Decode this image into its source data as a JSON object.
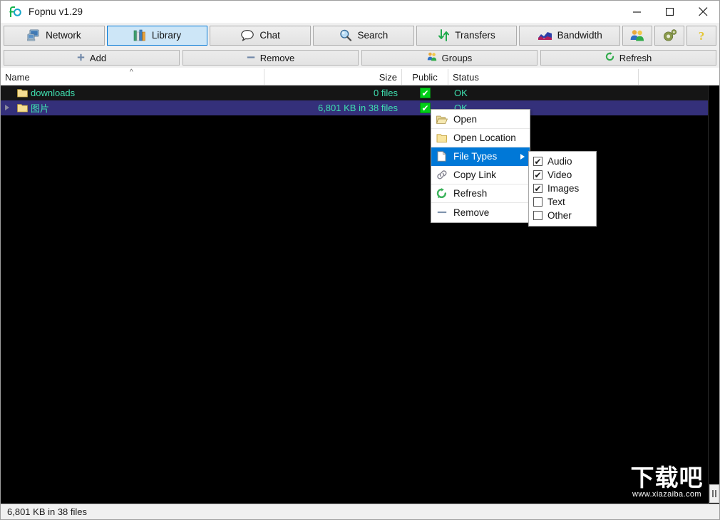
{
  "window": {
    "title": "Fopnu v1.29",
    "logo_icon": "fopnu-logo-icon",
    "minimize_label": "—",
    "maximize_label": "□",
    "close_label": "✕"
  },
  "tabs": [
    {
      "label": "Network",
      "icon": "computer-network-icon",
      "active": false
    },
    {
      "label": "Library",
      "icon": "books-library-icon",
      "active": true
    },
    {
      "label": "Chat",
      "icon": "speech-bubble-icon",
      "active": false
    },
    {
      "label": "Search",
      "icon": "magnifier-icon",
      "active": false
    },
    {
      "label": "Transfers",
      "icon": "up-down-arrows-icon",
      "active": false
    },
    {
      "label": "Bandwidth",
      "icon": "area-chart-icon",
      "active": false
    },
    {
      "label": "",
      "icon": "users-group-icon",
      "active": false
    },
    {
      "label": "",
      "icon": "gear-settings-icon",
      "active": false
    },
    {
      "label": "",
      "icon": "question-help-icon",
      "active": false
    }
  ],
  "actions": [
    {
      "label": "Add",
      "icon": "plus-icon"
    },
    {
      "label": "Remove",
      "icon": "minus-icon"
    },
    {
      "label": "Groups",
      "icon": "groups-icon"
    },
    {
      "label": "Refresh",
      "icon": "refresh-icon"
    }
  ],
  "table": {
    "columns": [
      {
        "label": "Name",
        "sort": "ascending"
      },
      {
        "label": "Size",
        "sort": ""
      },
      {
        "label": "Public",
        "sort": ""
      },
      {
        "label": "Status",
        "sort": ""
      }
    ],
    "sort_indicator": "^",
    "rows": [
      {
        "name": "downloads",
        "size": "0 files",
        "public": "✔",
        "status": "OK",
        "selected": false,
        "expandable": false,
        "icon": "folder-icon"
      },
      {
        "name": "图片",
        "size": "6,801 KB in 38 files",
        "public": "✔",
        "status": "OK",
        "selected": true,
        "expandable": true,
        "icon": "folder-icon"
      }
    ]
  },
  "context_menu": {
    "items": [
      {
        "label": "Open",
        "icon": "open-folder-icon",
        "selected": false,
        "has_submenu": false
      },
      {
        "label": "Open Location",
        "icon": "folder-icon",
        "selected": false,
        "has_submenu": false
      },
      {
        "label": "File Types",
        "icon": "file-page-icon",
        "selected": true,
        "has_submenu": true
      },
      {
        "label": "Copy Link",
        "icon": "link-chain-icon",
        "selected": false,
        "has_submenu": false
      },
      {
        "label": "Refresh",
        "icon": "refresh-icon",
        "selected": false,
        "has_submenu": false
      },
      {
        "label": "Remove",
        "icon": "minus-icon",
        "selected": false,
        "has_submenu": false
      }
    ]
  },
  "submenu": {
    "items": [
      {
        "label": "Audio",
        "checked": true,
        "check_glyph": "✔"
      },
      {
        "label": "Video",
        "checked": true,
        "check_glyph": "✔"
      },
      {
        "label": "Images",
        "checked": true,
        "check_glyph": "✔"
      },
      {
        "label": "Text",
        "checked": false,
        "check_glyph": ""
      },
      {
        "label": "Other",
        "checked": false,
        "check_glyph": ""
      }
    ]
  },
  "statusbar": {
    "text": "6,801 KB in 38 files"
  },
  "watermark": {
    "cn": "下载吧",
    "url": "www.xiazaiba.com"
  },
  "colors": {
    "accent_blue": "#0078d7",
    "tab_active_bg": "#cde6f7",
    "row_selected": "#34307a",
    "row_dark": "#151515",
    "text_green": "#3fe0b0",
    "check_green": "#00cf18",
    "body_bg": "#000000",
    "chrome_bg": "#f0f0f0"
  }
}
